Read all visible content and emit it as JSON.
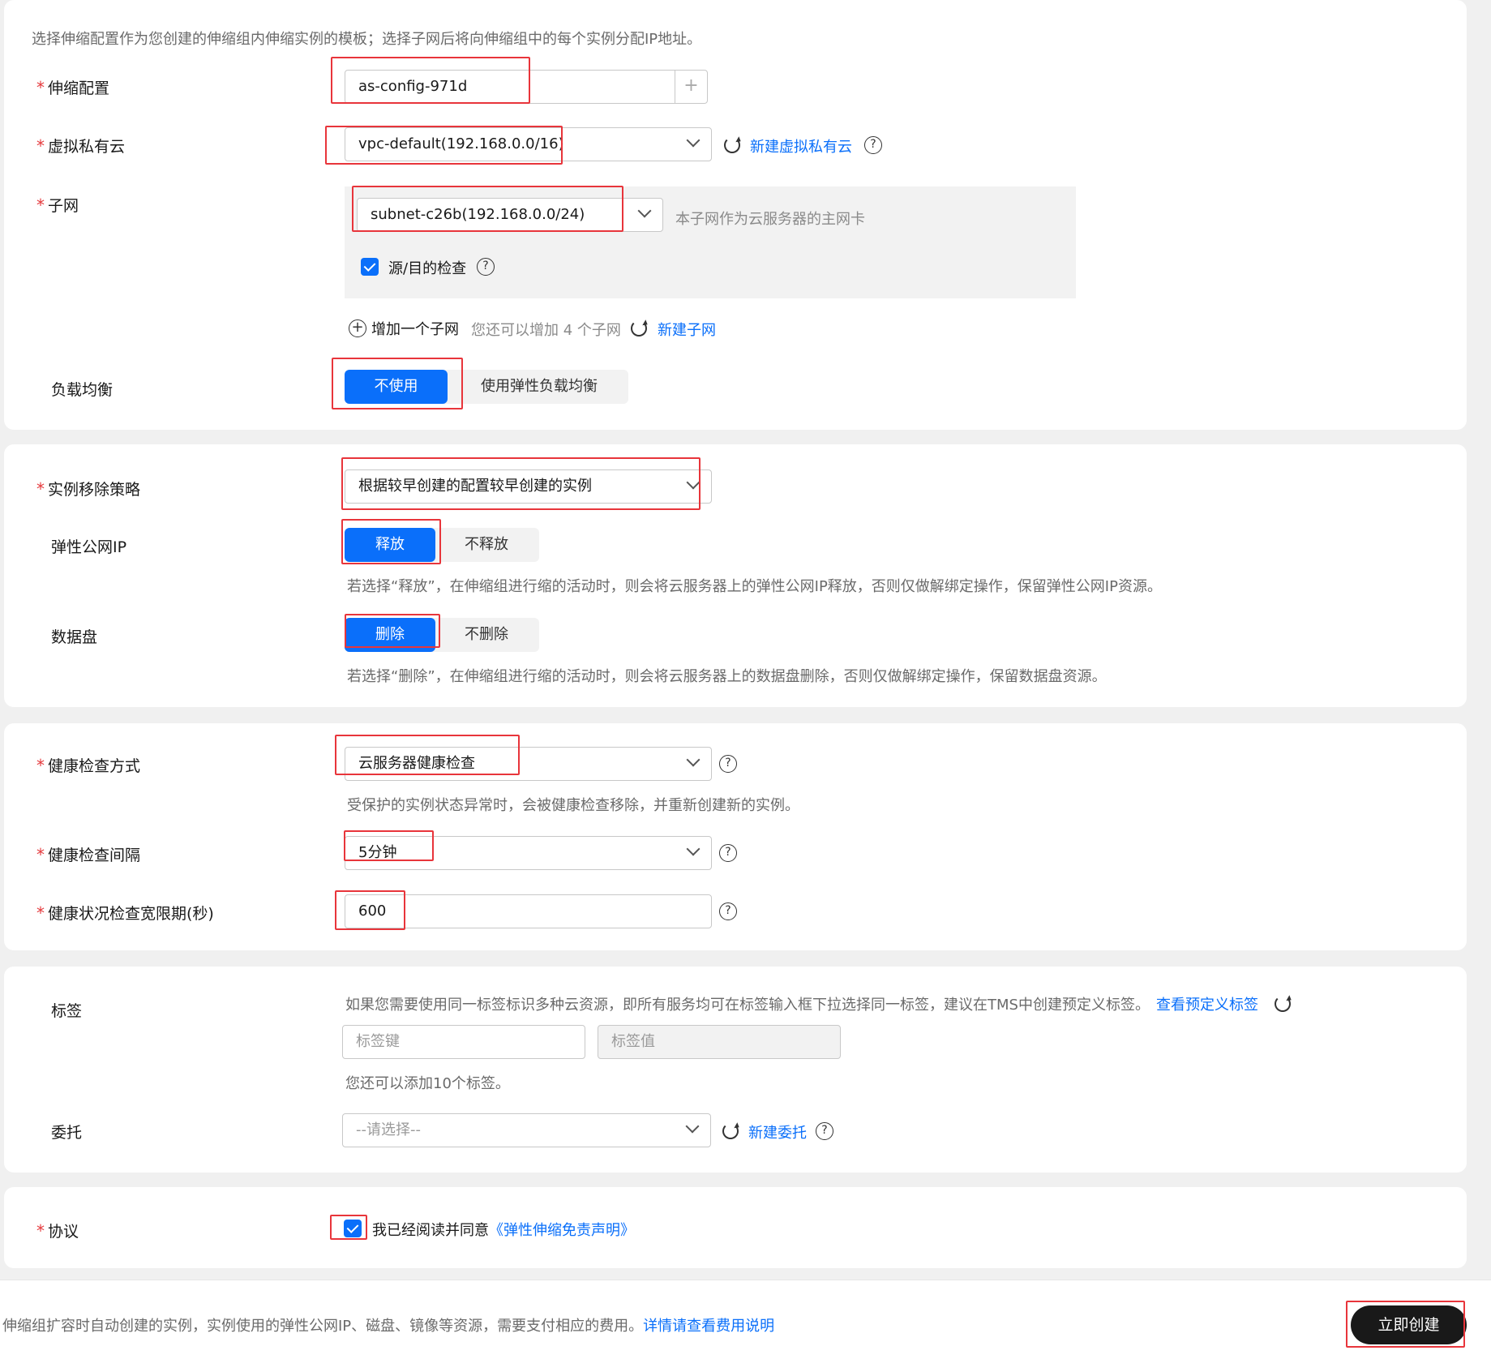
{
  "intro": "选择伸缩配置作为您创建的伸缩组内伸缩实例的模板；选择子网后将向伸缩组中的每个实例分配IP地址。",
  "required_mark": "*",
  "scaling_config": {
    "label": "伸缩配置",
    "value": "as-config-971d",
    "add_symbol": "+"
  },
  "vpc": {
    "label": "虚拟私有云",
    "value": "vpc-default(192.168.0.0/16)",
    "create_link": "新建虚拟私有云"
  },
  "subnet": {
    "label": "子网",
    "value": "subnet-c26b(192.168.0.0/24)",
    "primary_nic_hint": "本子网作为云服务器的主网卡",
    "source_dest_check": "源/目的检查",
    "add_subnet": "增加一个子网",
    "remaining_hint": "您还可以增加 4 个子网",
    "create_link": "新建子网"
  },
  "load_balance": {
    "label": "负载均衡",
    "options": [
      "不使用",
      "使用弹性负载均衡"
    ],
    "selected": "不使用"
  },
  "removal_policy": {
    "label": "实例移除策略",
    "value": "根据较早创建的配置较早创建的实例"
  },
  "eip": {
    "label": "弹性公网IP",
    "options": [
      "释放",
      "不释放"
    ],
    "selected": "释放",
    "hint": "若选择“释放”，在伸缩组进行缩的活动时，则会将云服务器上的弹性公网IP释放，否则仅做解绑定操作，保留弹性公网IP资源。"
  },
  "data_disk": {
    "label": "数据盘",
    "options": [
      "删除",
      "不删除"
    ],
    "selected": "删除",
    "hint": "若选择“删除”，在伸缩组进行缩的活动时，则会将云服务器上的数据盘删除，否则仅做解绑定操作，保留数据盘资源。"
  },
  "health_check": {
    "label": "健康检查方式",
    "value": "云服务器健康检查",
    "hint": "受保护的实例状态异常时，会被健康检查移除，并重新创建新的实例。"
  },
  "health_interval": {
    "label": "健康检查间隔",
    "value": "5分钟"
  },
  "grace_period": {
    "label": "健康状况检查宽限期(秒)",
    "value": "600"
  },
  "tags": {
    "label": "标签",
    "hint": "如果您需要使用同一标签标识多种云资源，即所有服务均可在标签输入框下拉选择同一标签，建议在TMS中创建预定义标签。",
    "view_link": "查看预定义标签",
    "key_placeholder": "标签键",
    "value_placeholder": "标签值",
    "remaining_hint": "您还可以添加10个标签。"
  },
  "agency": {
    "label": "委托",
    "placeholder": "--请选择--",
    "create_link": "新建委托"
  },
  "agreement": {
    "label": "协议",
    "text": "我已经阅读并同意",
    "link": "《弹性伸缩免责声明》"
  },
  "footer": {
    "notice": "伸缩组扩容时自动创建的实例，实例使用的弹性公网IP、磁盘、镜像等资源，需要支付相应的费用。",
    "link": "详情请查看费用说明",
    "create_button": "立即创建"
  },
  "icons": {
    "help": "?",
    "refresh": "refresh-icon",
    "chevron": "chevron-down-icon"
  },
  "colors": {
    "primary": "#0a6ffa",
    "required": "#e5393c",
    "highlight": "#e8353b",
    "button_dark": "#191919"
  }
}
